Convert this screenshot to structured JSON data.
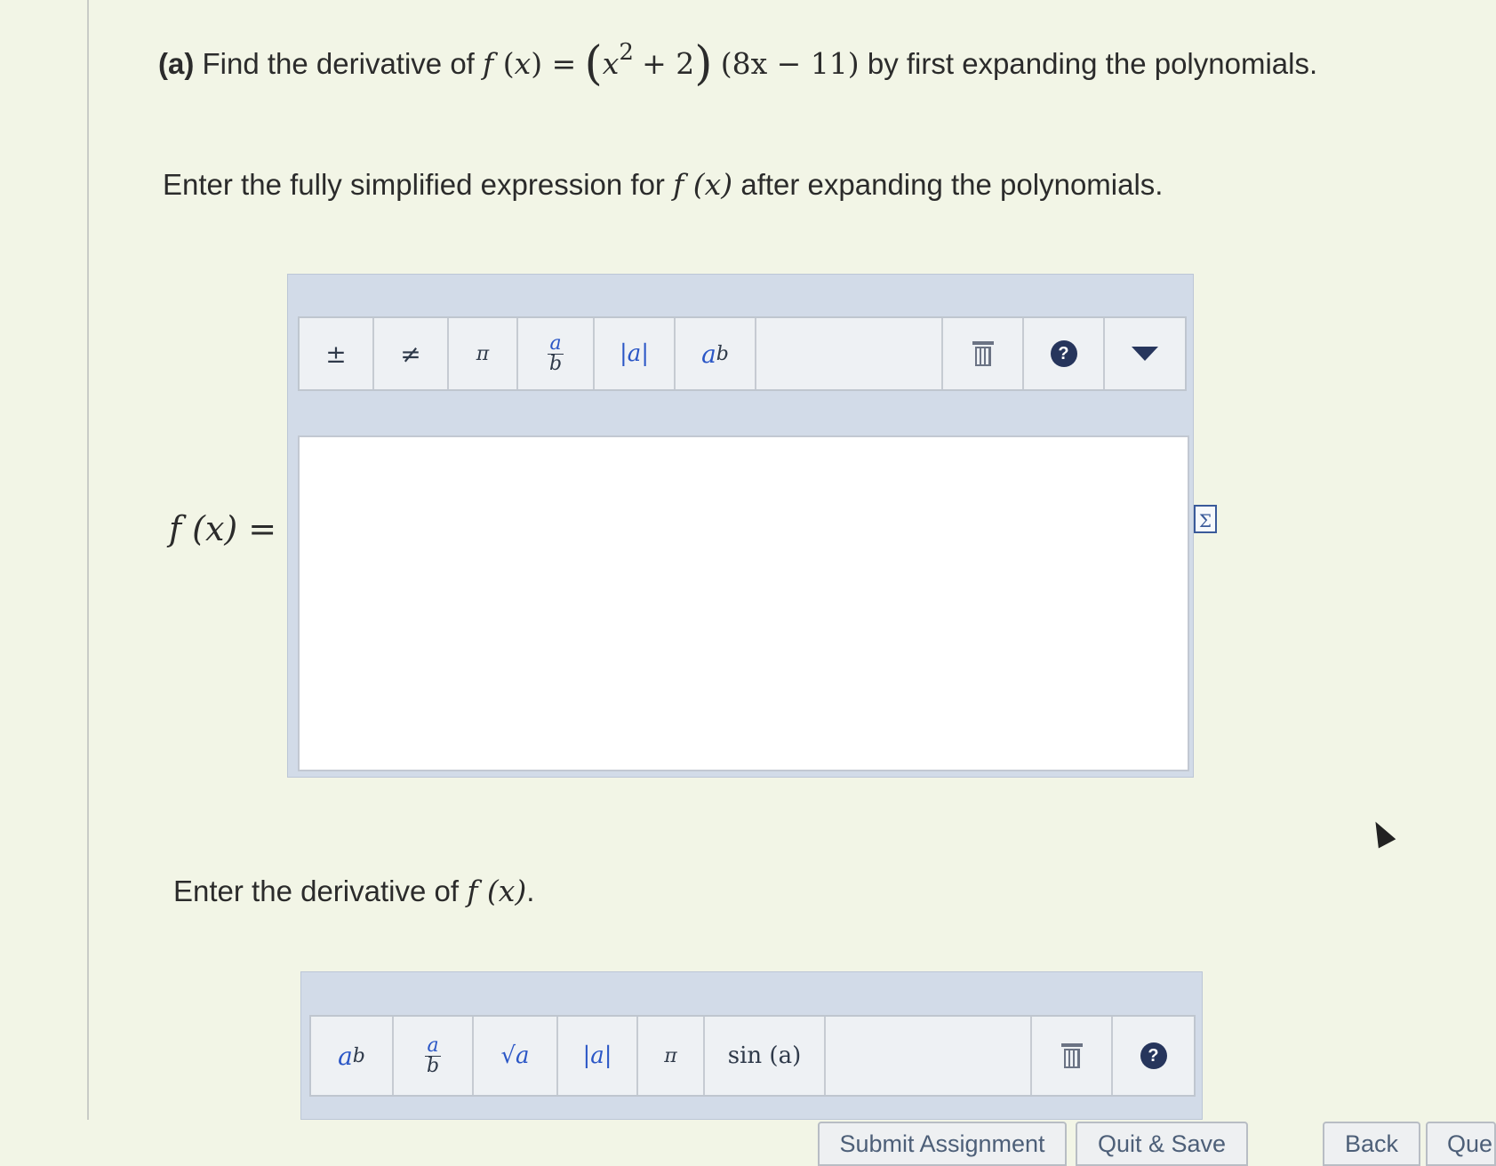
{
  "question": {
    "part": "(a)",
    "text_before": "Find the derivative of",
    "function_name": "f",
    "variable": "x",
    "paren_open": "(",
    "paren_close": ")",
    "equals": "=",
    "base": "x",
    "exp": "2",
    "plus": "+ 2",
    "factor2": "(8x − 11)",
    "text_after": "by first expanding the polynomials."
  },
  "prompt1": {
    "text_before": "Enter the fully simplified expression for",
    "fx": "f (x)",
    "text_after": "after expanding the polynomials."
  },
  "answer1": {
    "label": "f (x) =",
    "value": "",
    "toolbar": {
      "plus_minus": "±",
      "not_equal": "≠",
      "pi": "π",
      "frac_num": "a",
      "frac_den": "b",
      "abs": "|a|",
      "power_base": "a",
      "power_exp": "b"
    }
  },
  "prompt2": {
    "text_before": "Enter the derivative of",
    "fx": "f (x)",
    "text_after": "."
  },
  "answer2": {
    "toolbar": {
      "power_base": "a",
      "power_exp": "b",
      "frac_num": "a",
      "frac_den": "b",
      "sqrt": "√a",
      "abs": "|a|",
      "pi": "π",
      "sin": "sin (a)"
    }
  },
  "buttons": {
    "submit": "Submit Assignment",
    "quit": "Quit & Save",
    "back": "Back",
    "next": "Que"
  },
  "icons": {
    "trash": "trash-icon",
    "help": "help-icon",
    "dropdown": "dropdown-triangle-icon",
    "equation_editor": "equation-editor-icon",
    "help_glyph": "?",
    "sigma_glyph": "Σ"
  }
}
